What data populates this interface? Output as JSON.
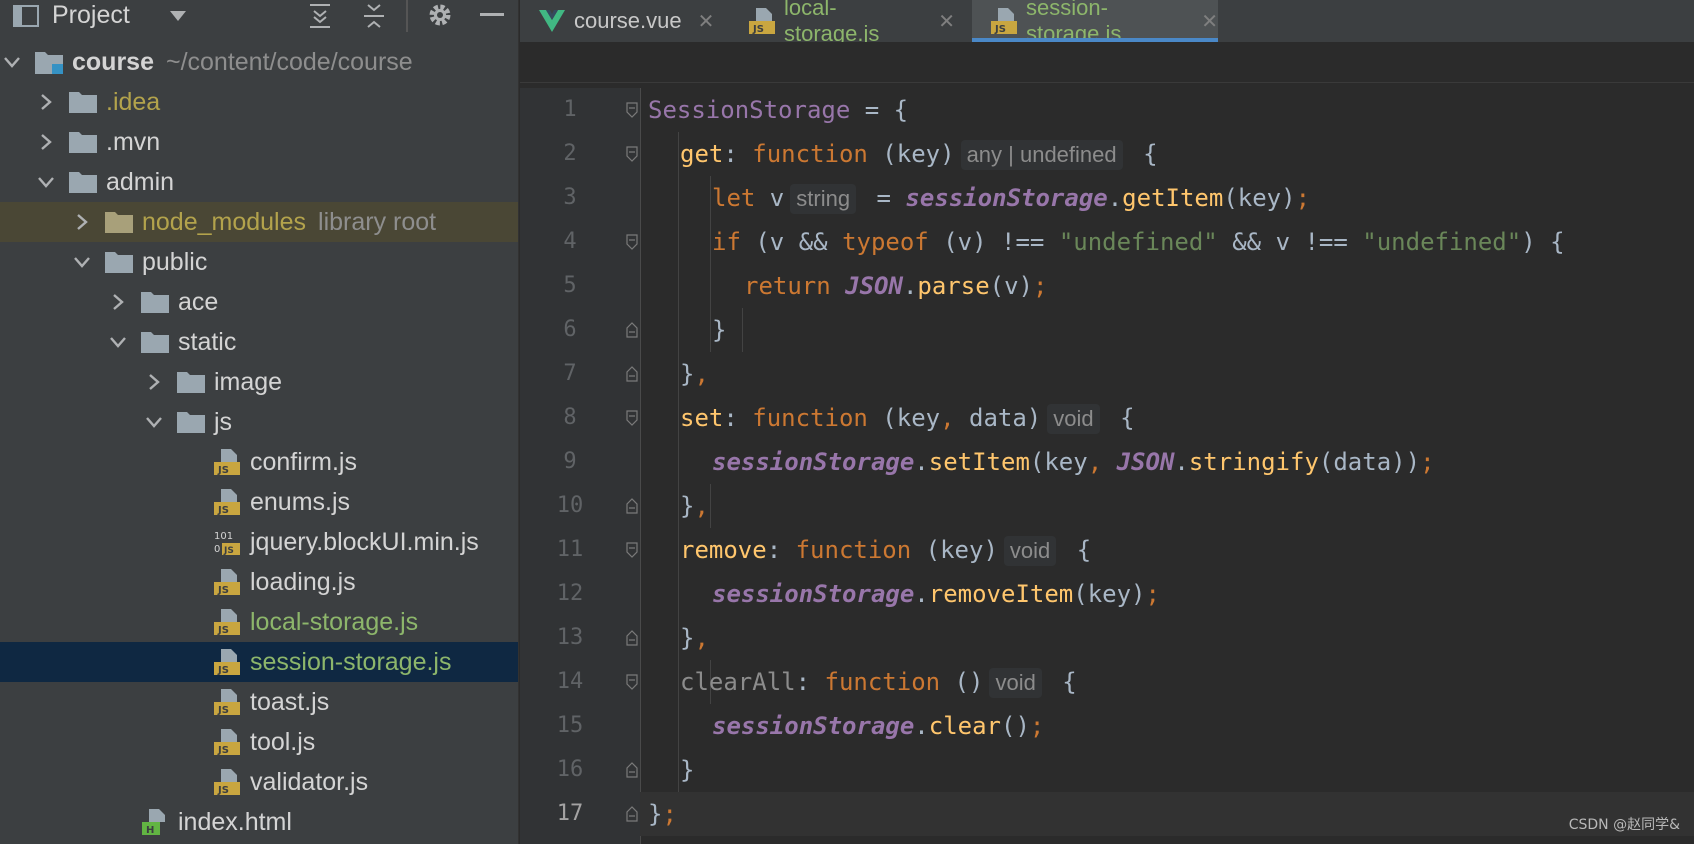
{
  "project_panel": {
    "title": "Project",
    "root": {
      "name": "course",
      "path": "~/content/code/course"
    },
    "items": [
      {
        "label": ".idea",
        "hint": ""
      },
      {
        "label": ".mvn",
        "hint": ""
      },
      {
        "label": "admin",
        "hint": ""
      },
      {
        "label": "node_modules",
        "hint": "library root"
      },
      {
        "label": "public",
        "hint": ""
      },
      {
        "label": "ace",
        "hint": ""
      },
      {
        "label": "static",
        "hint": ""
      },
      {
        "label": "image",
        "hint": ""
      },
      {
        "label": "js",
        "hint": ""
      },
      {
        "label": "confirm.js",
        "hint": ""
      },
      {
        "label": "enums.js",
        "hint": ""
      },
      {
        "label": "jquery.blockUI.min.js",
        "hint": ""
      },
      {
        "label": "loading.js",
        "hint": ""
      },
      {
        "label": "local-storage.js",
        "hint": ""
      },
      {
        "label": "session-storage.js",
        "hint": ""
      },
      {
        "label": "toast.js",
        "hint": ""
      },
      {
        "label": "tool.js",
        "hint": ""
      },
      {
        "label": "validator.js",
        "hint": ""
      },
      {
        "label": "index.html",
        "hint": ""
      }
    ]
  },
  "tabs": [
    {
      "label": "course.vue",
      "close": "✕"
    },
    {
      "label": "local-storage.js",
      "close": "✕"
    },
    {
      "label": "session-storage.js",
      "close": "✕"
    }
  ],
  "line_numbers": [
    "1",
    "2",
    "3",
    "4",
    "5",
    "6",
    "7",
    "8",
    "9",
    "10",
    "11",
    "12",
    "13",
    "14",
    "15",
    "16",
    "17"
  ],
  "code": {
    "l1": [
      "SessionStorage",
      " = {"
    ],
    "l2": [
      "get",
      ": ",
      "function",
      " (key)",
      "any | undefined",
      " {"
    ],
    "l3": [
      "let",
      " v",
      "string",
      " = ",
      "sessionStorage",
      ".",
      "getItem",
      "(key)",
      ";"
    ],
    "l4": [
      "if",
      " (v && ",
      "typeof",
      " (v) !== ",
      "\"undefined\"",
      " && v !== ",
      "\"undefined\"",
      ") {"
    ],
    "l5": [
      "return",
      " ",
      "JSON",
      ".",
      "parse",
      "(v)",
      ";"
    ],
    "l6": [
      "}"
    ],
    "l7": [
      "}",
      ","
    ],
    "l8": [
      "set",
      ": ",
      "function",
      " (key",
      ",",
      " data)",
      "void",
      " {"
    ],
    "l9": [
      "sessionStorage",
      ".",
      "setItem",
      "(key",
      ",",
      " ",
      "JSON",
      ".",
      "stringify",
      "(data))",
      ";"
    ],
    "l10": [
      "}",
      ","
    ],
    "l11": [
      "remove",
      ": ",
      "function",
      " (key)",
      "void",
      " {"
    ],
    "l12": [
      "sessionStorage",
      ".",
      "removeItem",
      "(key)",
      ";"
    ],
    "l13": [
      "}",
      ","
    ],
    "l14": [
      "clearAll",
      ": ",
      "function",
      " ()",
      "void",
      " {"
    ],
    "l15": [
      "sessionStorage",
      ".",
      "clear",
      "()",
      ";"
    ],
    "l16": [
      "}"
    ],
    "l17": [
      "}",
      ";"
    ]
  },
  "watermark": "CSDN @赵同学&",
  "colors": {
    "accent": "#4a88c7",
    "keyword": "#cc7832",
    "function": "#ffc66d",
    "string": "#6a8759",
    "property": "#9876aa"
  }
}
